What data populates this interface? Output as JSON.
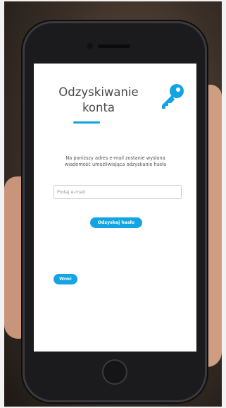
{
  "recovery": {
    "title_line1": "Odzyskiwanie",
    "title_line2": "konta",
    "info_text": "Na poniższy adres e-mail zostanie wysłana wiadomość umożliwiająca odzyskanie hasła",
    "email_placeholder": "Podaj e-mail",
    "email_value": "",
    "recover_label": "Odzyskaj hasło",
    "back_label": "Wróć"
  },
  "icons": {
    "key": "key-icon"
  },
  "colors": {
    "accent": "#12a4e3",
    "title_text": "#4a4a4a",
    "screen_bg": "#ffffff"
  }
}
